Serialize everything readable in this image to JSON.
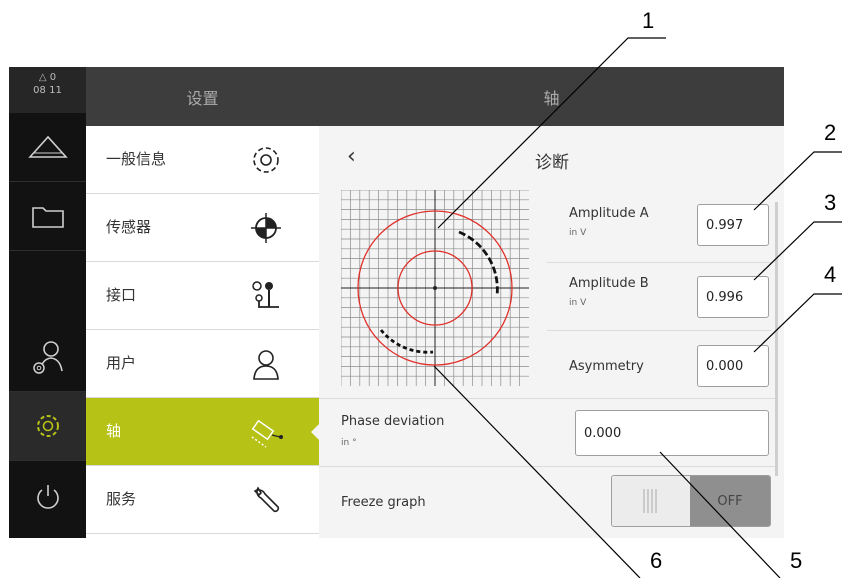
{
  "status": {
    "warnings": "0",
    "time": "08 11"
  },
  "sidebar_icons": [
    "measure-icon",
    "folder-icon",
    "user-settings-icon",
    "settings-gear-icon",
    "power-icon"
  ],
  "menu": {
    "title": "设置",
    "items": [
      {
        "label": "一般信息",
        "icon": "gear-icon"
      },
      {
        "label": "传感器",
        "icon": "sensor-icon"
      },
      {
        "label": "接口",
        "icon": "interface-icon"
      },
      {
        "label": "用户",
        "icon": "user-icon"
      },
      {
        "label": "轴",
        "icon": "axis-icon",
        "selected": true
      },
      {
        "label": "服务",
        "icon": "wrench-icon"
      }
    ]
  },
  "panel": {
    "header": "轴",
    "title": "诊断",
    "amplitude_a": {
      "label": "Amplitude A",
      "unit": "in V",
      "value": "0.997"
    },
    "amplitude_b": {
      "label": "Amplitude B",
      "unit": "in V",
      "value": "0.996"
    },
    "asymmetry": {
      "label": "Asymmetry",
      "value": "0.000"
    },
    "phase_deviation": {
      "label": "Phase deviation",
      "unit": "in °",
      "value": "0.000"
    },
    "freeze_graph": {
      "label": "Freeze graph",
      "state": "OFF"
    }
  },
  "callouts": [
    "1",
    "2",
    "3",
    "4",
    "5",
    "6"
  ],
  "colors": {
    "accent": "#b7c217",
    "circle": "#e0302a",
    "dark": "#121212"
  }
}
